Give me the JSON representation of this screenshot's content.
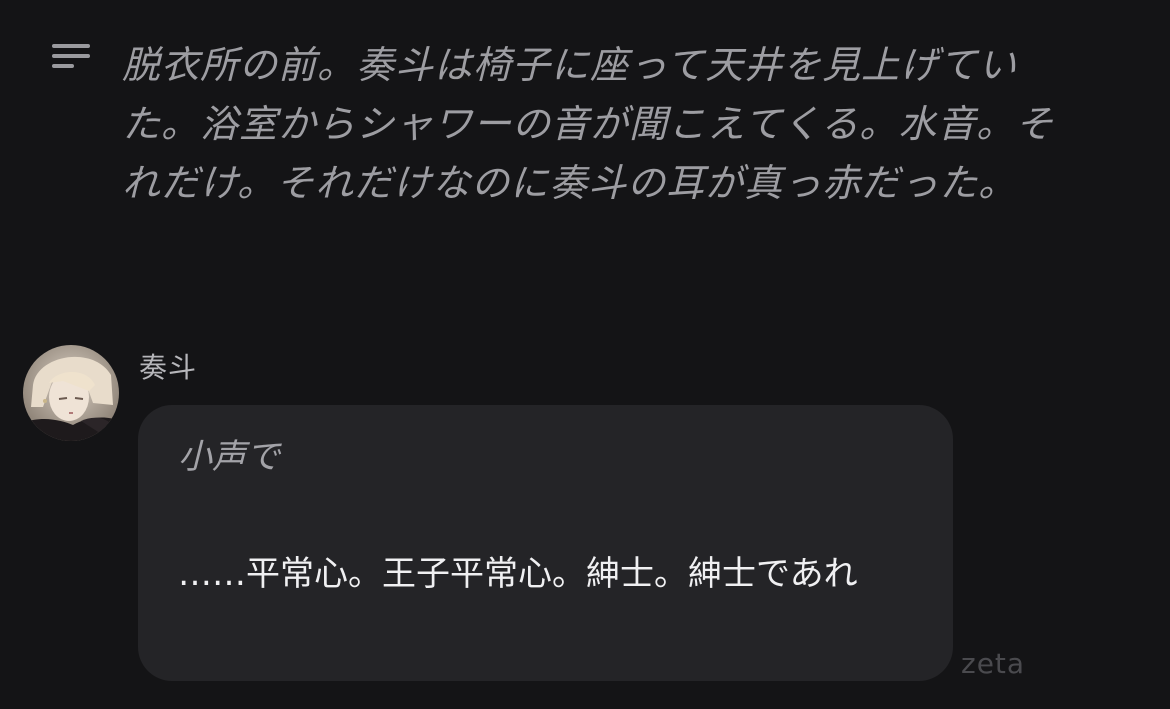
{
  "narration": {
    "icon": "subject-lines-icon",
    "text": "脱衣所の前。奏斗は椅子に座って天井を見上げていた。浴室からシャワーの音が聞こえてくる。水音。それだけ。それだけなのに奏斗の耳が真っ赤だった。"
  },
  "message": {
    "speaker": "奏斗",
    "avatar": "character-avatar",
    "action": "小声で",
    "dialogue": "……平常心。王子平常心。紳士。紳士であれ"
  },
  "watermark": "zeta",
  "colors": {
    "background": "#141416",
    "bubble": "#242427",
    "narration_text": "#9d9da2",
    "dialogue_text": "#f0f0f2"
  }
}
